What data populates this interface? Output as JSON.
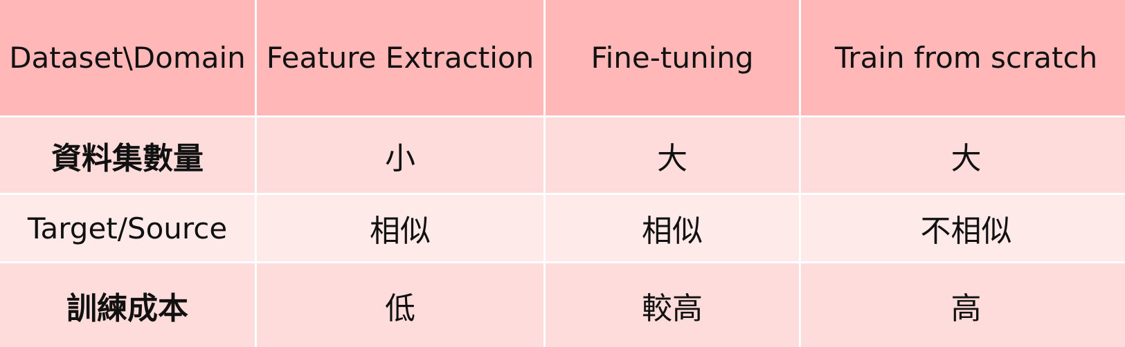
{
  "header": {
    "col0": "Dataset\\Domain",
    "col1": "Feature Extraction",
    "col2": "Fine-tuning",
    "col3": "Train from scratch"
  },
  "rows": [
    {
      "label": "資料集數量",
      "c1": "小",
      "c2": "大",
      "c3": "大"
    },
    {
      "label": "Target/Source",
      "c1": "相似",
      "c2": "相似",
      "c3": "不相似"
    },
    {
      "label": "訓練成本",
      "c1": "低",
      "c2": "較高",
      "c3": "高"
    }
  ],
  "colors": {
    "header_bg": "#ffb7b7",
    "row_bg_dark": "#ffdcdc",
    "row_bg_light": "#ffeaea",
    "border": "#ffffff"
  }
}
